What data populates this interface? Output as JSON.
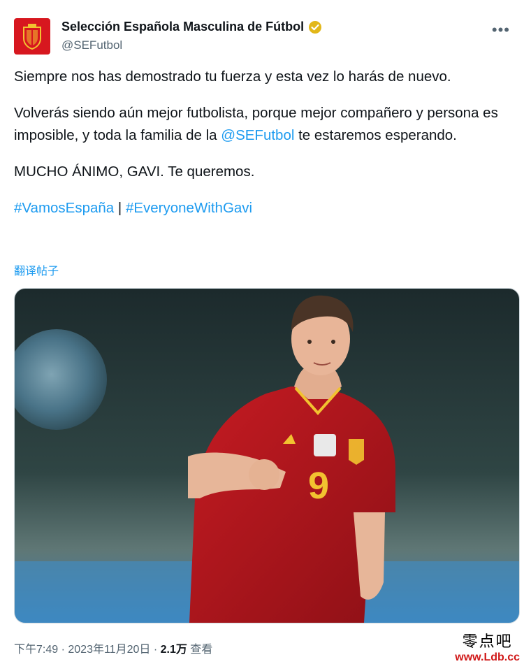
{
  "author": {
    "display_name": "Selección Española Masculina de Fútbol",
    "handle": "@SEFutbol",
    "verified_badge_icon": "verified-badge-icon",
    "avatar_icon": "spain-crest-icon"
  },
  "tweet": {
    "line1": "Siempre nos has demostrado tu fuerza y esta vez lo harás de nuevo.",
    "para2_before": "Volverás siendo aún mejor futbolista, porque mejor compañero y persona es imposible, y toda la familia de la ",
    "para2_mention": "@SEFutbol",
    "para2_after": " te estaremos esperando.",
    "line3": "MUCHO ÁNIMO, GAVI. Te queremos.",
    "hashtag1": "#VamosEspaña",
    "separator": " | ",
    "hashtag2": "#EveryoneWithGavi",
    "translate_label": "翻译帖子"
  },
  "media": {
    "jersey_number": "9",
    "description_icon": "player-photo"
  },
  "meta": {
    "time": "下午7:49",
    "dot": " · ",
    "date": "2023年11月20日",
    "views_count": "2.1万",
    "views_label": " 查看"
  },
  "watermark": {
    "line1": "零点吧",
    "line2": "www.Ldb.cc"
  },
  "colors": {
    "link": "#1d9bf0",
    "secondary_text": "#536471",
    "crest_red": "#d7171f"
  }
}
